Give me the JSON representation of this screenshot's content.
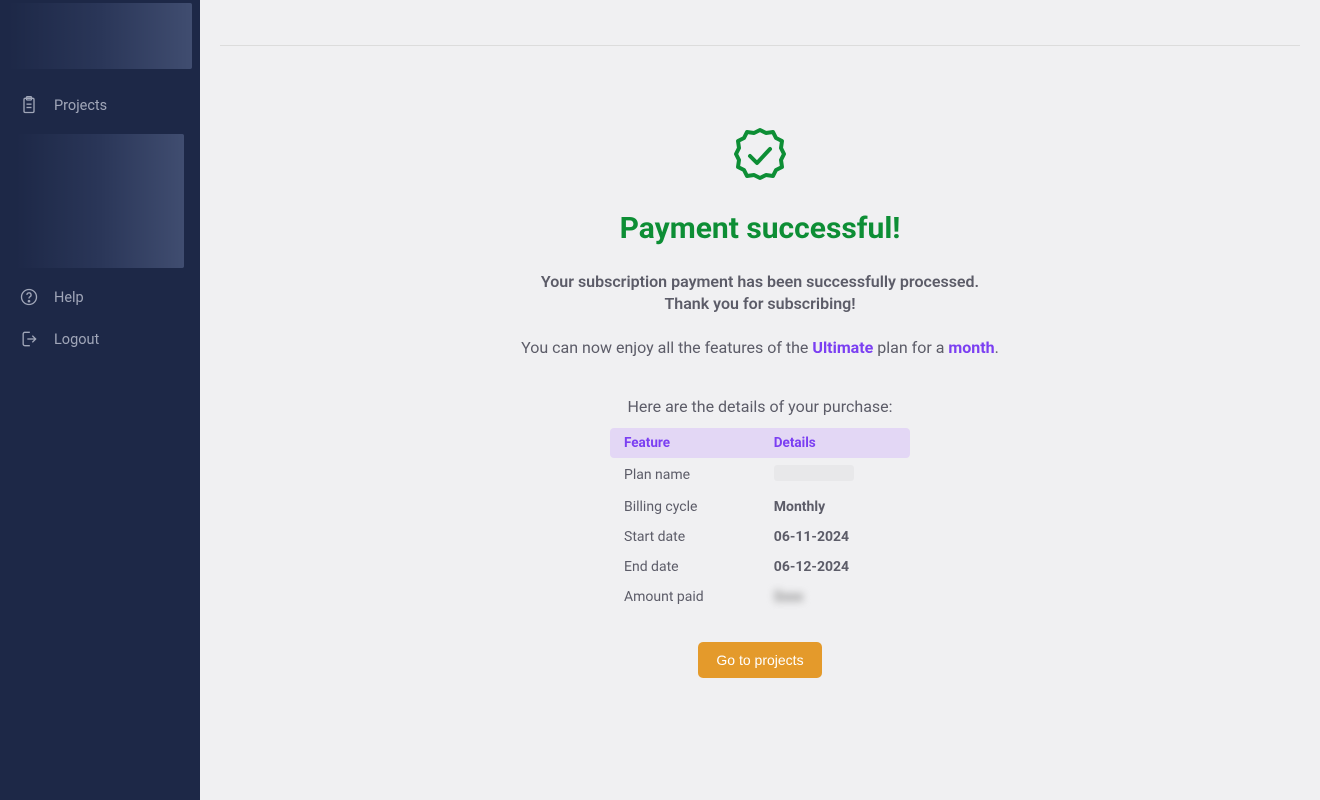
{
  "sidebar": {
    "items": [
      {
        "label": "Projects"
      },
      {
        "label": "Help"
      },
      {
        "label": "Logout"
      }
    ]
  },
  "main": {
    "title": "Payment successful!",
    "subtitle_line1": "Your subscription payment has been successfully processed.",
    "subtitle_line2": "Thank you for subscribing!",
    "feature_pre": "You can now enjoy all the features of the ",
    "plan_name": "Ultimate",
    "feature_mid": " plan for a ",
    "period": "month",
    "feature_end": ".",
    "details_heading": "Here are the details of your purchase:",
    "cta": "Go to projects"
  },
  "table": {
    "headers": [
      "Feature",
      "Details"
    ],
    "rows": [
      {
        "feature": "Plan name",
        "detail": ""
      },
      {
        "feature": "Billing cycle",
        "detail": "Monthly"
      },
      {
        "feature": "Start date",
        "detail": "06-11-2024"
      },
      {
        "feature": "End date",
        "detail": "06-12-2024"
      },
      {
        "feature": "Amount paid",
        "detail": ""
      }
    ]
  },
  "colors": {
    "accent_green": "#0d8e35",
    "accent_purple": "#7b3ff2",
    "button_orange": "#e49a2b",
    "sidebar_bg": "#1d2847"
  }
}
